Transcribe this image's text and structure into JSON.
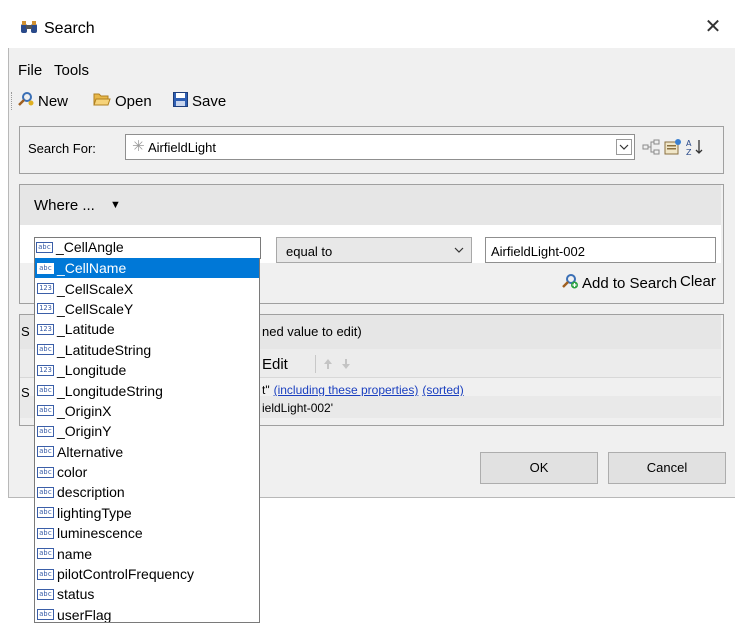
{
  "window": {
    "title": "Search",
    "close": "✕"
  },
  "menu": {
    "file": "File",
    "tools": "Tools"
  },
  "toolbar": {
    "new": "New",
    "open": "Open",
    "save": "Save"
  },
  "search_for": {
    "label": "Search For:",
    "value": "AirfieldLight",
    "prefix": "✳"
  },
  "where": {
    "label": "Where ...",
    "caret": "▼",
    "operator": "equal to",
    "value": "AirfieldLight-002",
    "add_to_search": "Add to Search",
    "clear": "Clear"
  },
  "property_list": {
    "current": {
      "label": "_CellAngle",
      "type": "abc"
    },
    "items": [
      {
        "label": "_CellName",
        "type": "abc",
        "selected": true
      },
      {
        "label": "_CellScaleX",
        "type": "123"
      },
      {
        "label": "_CellScaleY",
        "type": "123"
      },
      {
        "label": "_Latitude",
        "type": "123"
      },
      {
        "label": "_LatitudeString",
        "type": "abc"
      },
      {
        "label": "_Longitude",
        "type": "123"
      },
      {
        "label": "_LongitudeString",
        "type": "abc"
      },
      {
        "label": "_OriginX",
        "type": "abc"
      },
      {
        "label": "_OriginY",
        "type": "abc"
      },
      {
        "label": "Alternative",
        "type": "abc"
      },
      {
        "label": "color",
        "type": "abc"
      },
      {
        "label": "description",
        "type": "abc"
      },
      {
        "label": "lightingType",
        "type": "abc"
      },
      {
        "label": "luminescence",
        "type": "abc"
      },
      {
        "label": "name",
        "type": "abc"
      },
      {
        "label": "pilotControlFrequency",
        "type": "abc"
      },
      {
        "label": "status",
        "type": "abc"
      },
      {
        "label": "userFlag",
        "type": "abc"
      }
    ]
  },
  "results": {
    "title_fragment": "ned value to edit)",
    "edit": "Edit",
    "row1_fragment": "t\"",
    "row1_link1": "(including these properties)",
    "row1_link2": "(sorted)",
    "row2_fragment": "ieldLight-002'",
    "edge_s1": "S",
    "edge_s2": "S"
  },
  "buttons": {
    "ok": "OK",
    "cancel": "Cancel"
  },
  "colors": {
    "selection": "#0078d7",
    "link": "#1a3fbf",
    "window_bg": "#f0f0f0"
  }
}
